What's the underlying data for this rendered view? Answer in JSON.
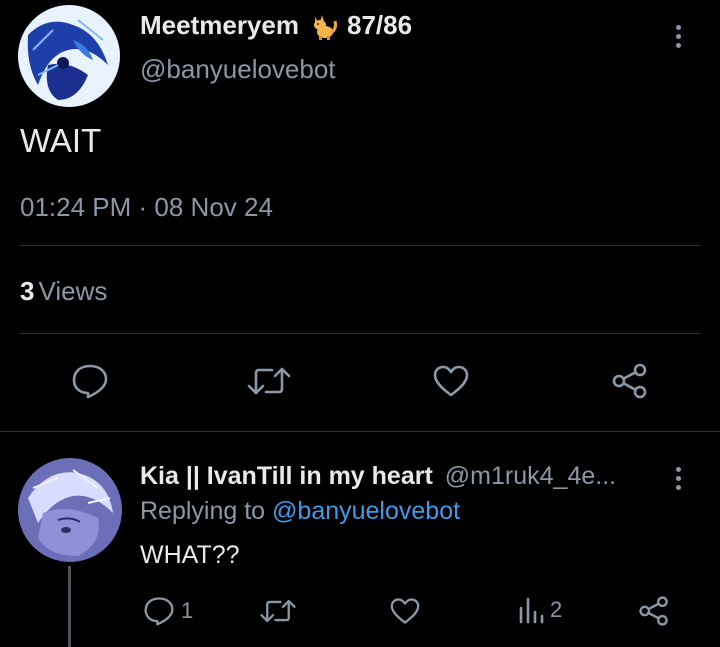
{
  "tweet": {
    "author": {
      "display_name": "Meetmeryem",
      "emoji": "cat-emoji",
      "score": "87/86",
      "handle": "@banyuelovebot"
    },
    "text": "WAIT",
    "timestamp": "01:24 PM · 08 Nov 24",
    "views_count": "3",
    "views_label": "Views",
    "actions": [
      "reply-icon",
      "retweet-icon",
      "like-icon",
      "share-icon"
    ]
  },
  "reply": {
    "author": {
      "display_name": "Kia || IvanTill in my heart",
      "handle": "@m1ruk4_4e..."
    },
    "replying_prefix": "Replying to",
    "replying_to": "@banyuelovebot",
    "text": "WHAT??",
    "reply_count": "1",
    "views_count": "2",
    "actions": [
      "reply-icon",
      "retweet-icon",
      "like-icon",
      "views-icon",
      "share-icon"
    ]
  },
  "colors": {
    "background": "#000000",
    "text_primary": "#e7e9ea",
    "text_secondary": "#8b98a5",
    "link": "#3d9be9",
    "divider": "#2f3336"
  }
}
